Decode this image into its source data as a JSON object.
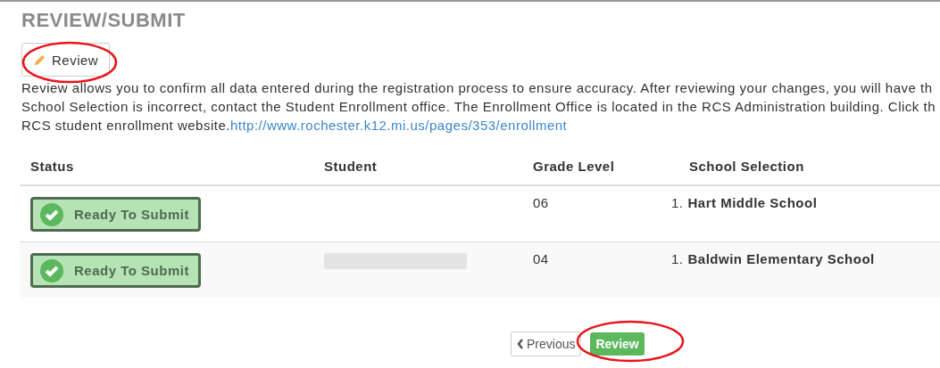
{
  "title": "REVIEW/SUBMIT",
  "review_button": {
    "label": "Review"
  },
  "description": {
    "lines": [
      "Review allows you to confirm all data entered during the registration process to ensure accuracy. After reviewing your changes, you will have th",
      "School Selection is incorrect, contact the Student Enrollment office. The Enrollment Office is located in the RCS Administration building. Click th",
      "RCS student enrollment website."
    ],
    "link": "http://www.rochester.k12.mi.us/pages/353/enrollment"
  },
  "table": {
    "columns": [
      "Status",
      "Student",
      "Grade Level",
      "School Selection"
    ],
    "rows": [
      {
        "status": "Ready To Submit",
        "student_redacted": false,
        "grade": "06",
        "school_number": "1.",
        "school": "Hart Middle School"
      },
      {
        "status": "Ready To Submit",
        "student_redacted": true,
        "grade": "04",
        "school_number": "1.",
        "school": "Baldwin Elementary School"
      }
    ]
  },
  "footer": {
    "previous": "Previous",
    "review": "Review"
  }
}
